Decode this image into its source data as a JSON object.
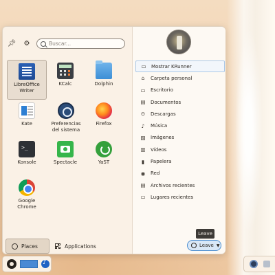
{
  "launcher": {
    "search_placeholder": "Buscar...",
    "apps": [
      {
        "label": "LibreOffice Writer",
        "icon": "libreoffice-writer-icon",
        "selected": true
      },
      {
        "label": "KCalc",
        "icon": "kcalc-icon"
      },
      {
        "label": "Dolphin",
        "icon": "dolphin-folder-icon"
      },
      {
        "label": "Kate",
        "icon": "kate-editor-icon"
      },
      {
        "label": "Preferencias del sistema",
        "icon": "system-settings-icon"
      },
      {
        "label": "Firefox",
        "icon": "firefox-icon"
      },
      {
        "label": "Konsole",
        "icon": "konsole-terminal-icon"
      },
      {
        "label": "Spectacle",
        "icon": "spectacle-camera-icon"
      },
      {
        "label": "YaST",
        "icon": "yast-icon"
      },
      {
        "label": "Google Chrome",
        "icon": "chrome-icon"
      }
    ],
    "tabs": {
      "places": "Places",
      "applications": "Applications"
    },
    "places": [
      {
        "label": "Mostrar KRunner",
        "icon": "krunner-icon"
      },
      {
        "label": "Carpeta personal",
        "icon": "home-icon"
      },
      {
        "label": "Escritorio",
        "icon": "desktop-icon"
      },
      {
        "label": "Documentos",
        "icon": "documents-icon"
      },
      {
        "label": "Descargas",
        "icon": "downloads-icon"
      },
      {
        "label": "Música",
        "icon": "music-icon"
      },
      {
        "label": "Imágenes",
        "icon": "images-icon"
      },
      {
        "label": "Vídeos",
        "icon": "videos-icon"
      },
      {
        "label": "Papelera",
        "icon": "trash-icon"
      },
      {
        "label": "Red",
        "icon": "network-icon"
      },
      {
        "label": "Archivos recientes",
        "icon": "recent-files-icon"
      },
      {
        "label": "Lugares recientes",
        "icon": "recent-places-icon"
      }
    ],
    "leave_tooltip": "Leave",
    "leave_label": "Leave"
  },
  "colors": {
    "accent": "#4d8fd0",
    "panel_bg": "#faf1e6"
  }
}
